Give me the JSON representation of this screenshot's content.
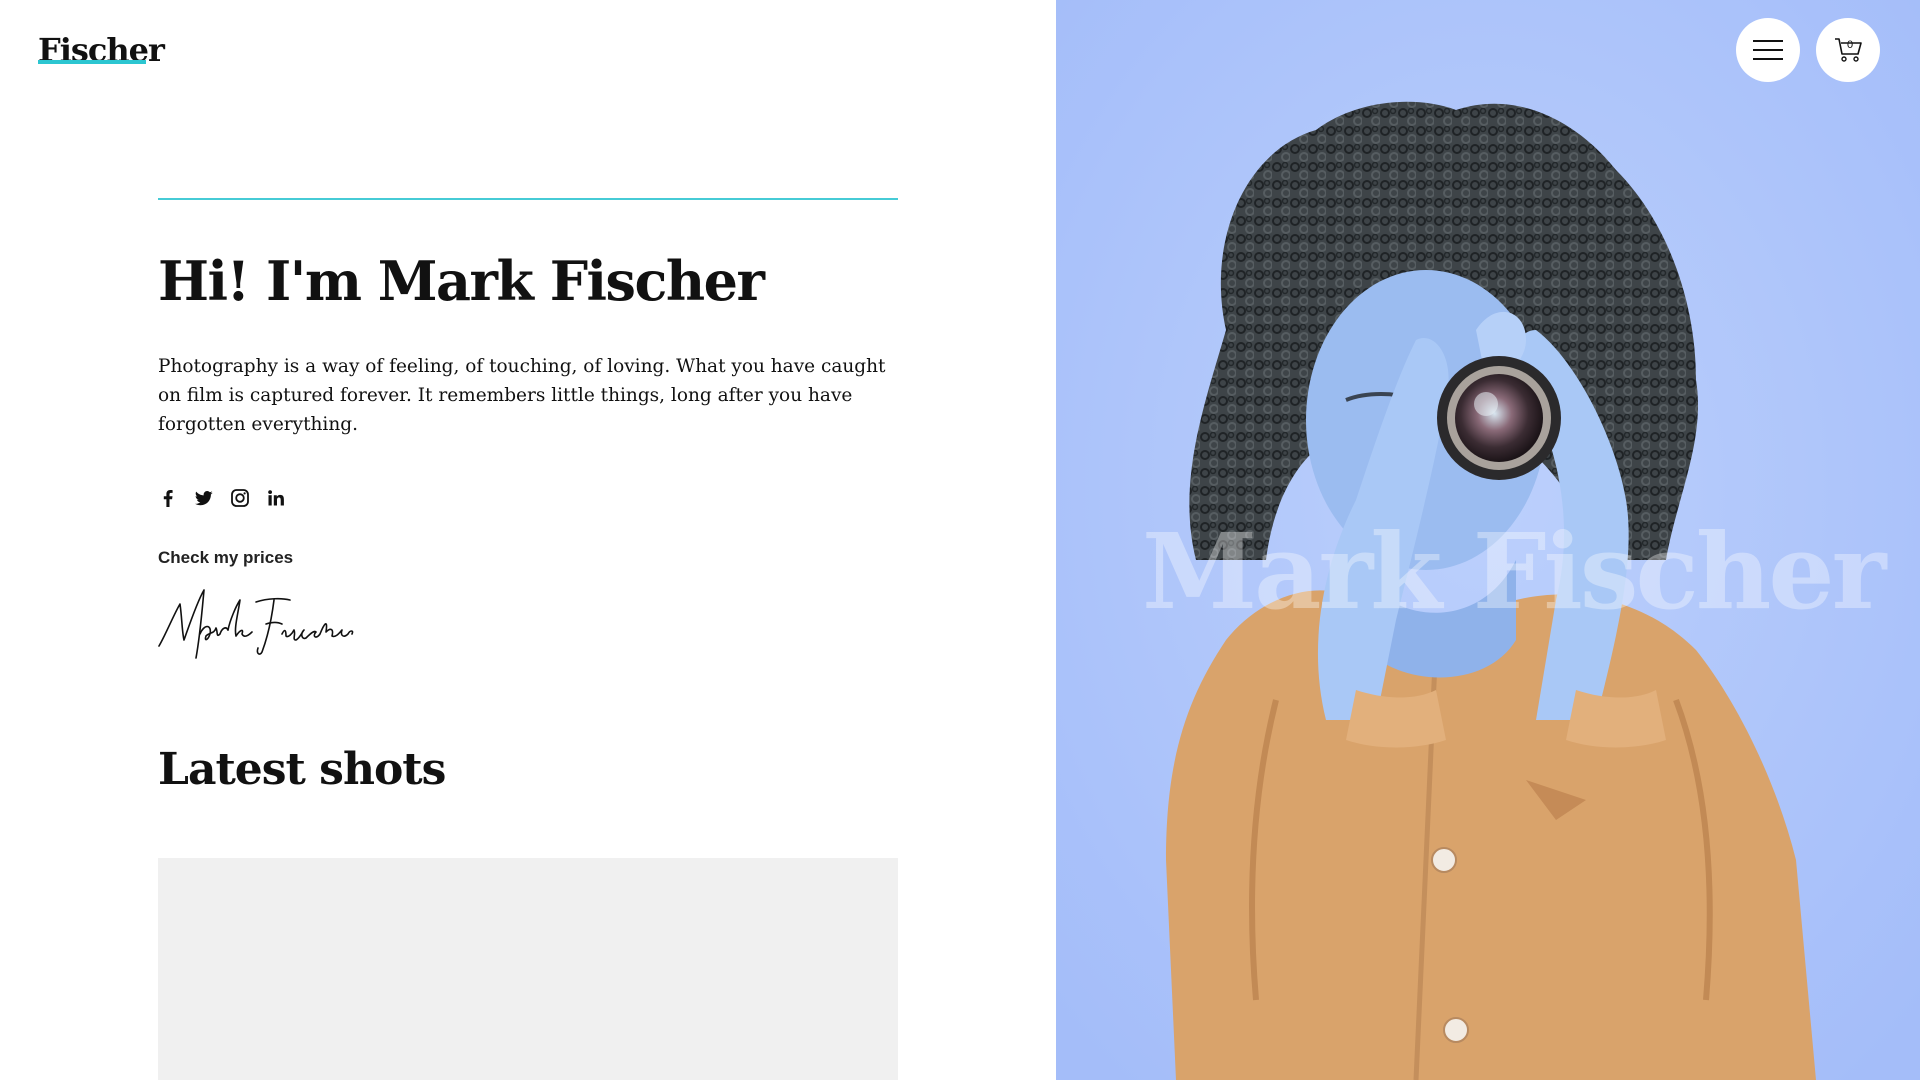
{
  "brand": {
    "logo": "Fischer",
    "accent_color": "#2cc6d1"
  },
  "hero": {
    "title": "Hi! I'm Mark Fischer",
    "intro": "Photography is a way of feeling, of touching, of loving. What you have caught on film is captured forever. It remembers little things, long after you have forgotten everything.",
    "prices_link": "Check my prices",
    "signature_alt": "Mark Fischer signature"
  },
  "social": [
    {
      "name": "facebook",
      "icon": "facebook-icon"
    },
    {
      "name": "twitter",
      "icon": "twitter-icon"
    },
    {
      "name": "instagram",
      "icon": "instagram-icon"
    },
    {
      "name": "linkedin",
      "icon": "linkedin-icon"
    }
  ],
  "latest": {
    "title": "Latest shots"
  },
  "photo_panel": {
    "overlay_name": "Mark Fischer",
    "background_color": "#a9c1fb",
    "jacket_color": "#d9a36b"
  },
  "header_buttons": {
    "menu_icon": "hamburger-menu-icon",
    "cart_icon": "shopping-cart-icon",
    "cart_count": "0"
  }
}
